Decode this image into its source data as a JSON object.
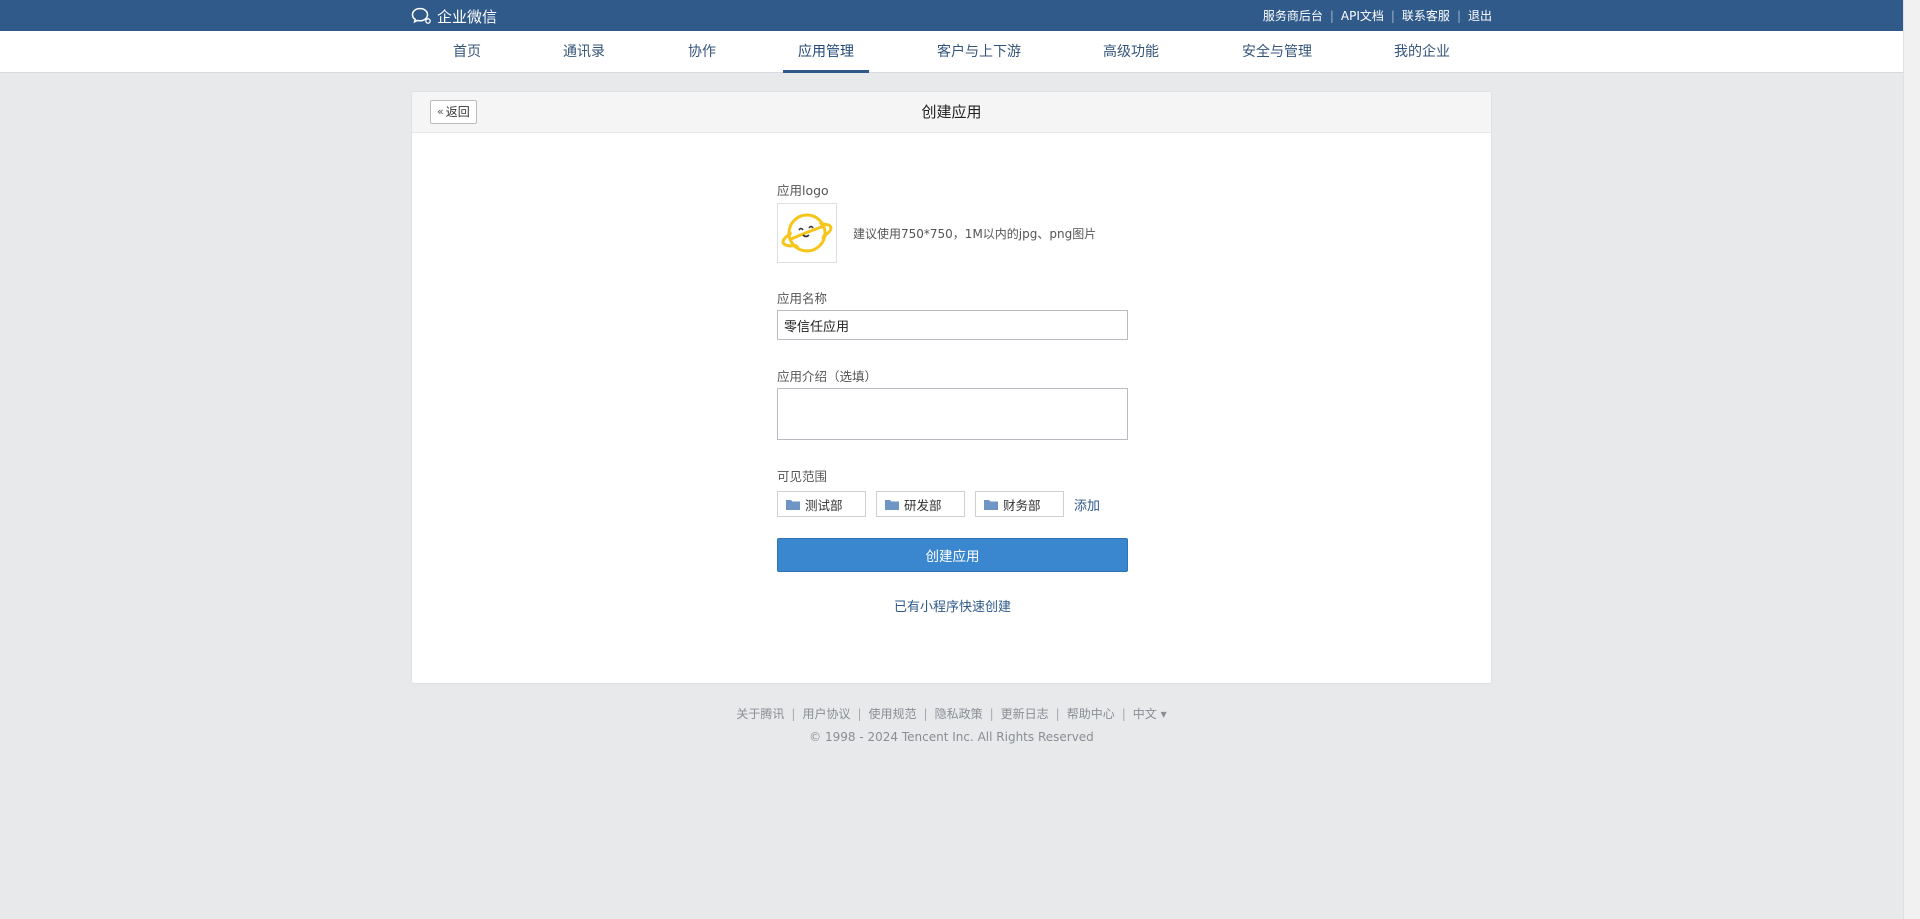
{
  "topbar": {
    "brand": "企业微信",
    "links": [
      "服务商后台",
      "API文档",
      "联系客服",
      "退出"
    ]
  },
  "nav": {
    "items": [
      "首页",
      "通讯录",
      "协作",
      "应用管理",
      "客户与上下游",
      "高级功能",
      "安全与管理",
      "我的企业"
    ],
    "active": "应用管理"
  },
  "card": {
    "back_label": "返回",
    "title": "创建应用"
  },
  "form": {
    "logo_label": "应用logo",
    "logo_hint": "建议使用750*750，1M以内的jpg、png图片",
    "name_label": "应用名称",
    "name_value": "零信任应用",
    "intro_label": "应用介绍（选填）",
    "intro_value": "",
    "scope_label": "可见范围",
    "departments": [
      "测试部",
      "研发部",
      "财务部"
    ],
    "add_label": "添加",
    "create_button": "创建应用",
    "mini_program_link": "已有小程序快速创建"
  },
  "footer": {
    "links": [
      "关于腾讯",
      "用户协议",
      "使用规范",
      "隐私政策",
      "更新日志",
      "帮助中心",
      "中文 ▾"
    ],
    "copyright": "© 1998 - 2024 Tencent Inc. All Rights Reserved"
  },
  "colors": {
    "topbar": "#2f5a8a",
    "primary_button": "#3a87cf",
    "logo_yellow": "#f5c518"
  }
}
